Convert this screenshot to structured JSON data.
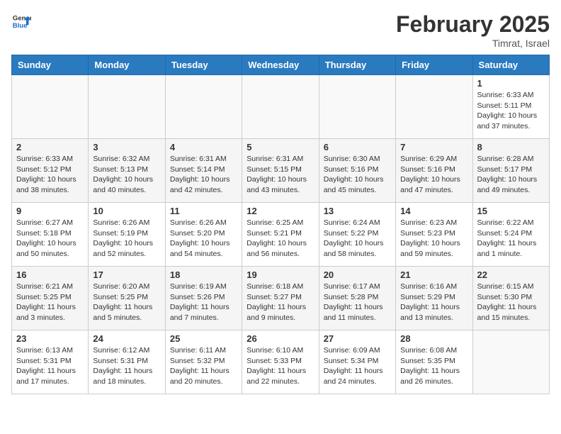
{
  "header": {
    "logo_general": "General",
    "logo_blue": "Blue",
    "month_year": "February 2025",
    "location": "Timrat, Israel"
  },
  "days_of_week": [
    "Sunday",
    "Monday",
    "Tuesday",
    "Wednesday",
    "Thursday",
    "Friday",
    "Saturday"
  ],
  "weeks": [
    [
      {
        "day": "",
        "info": ""
      },
      {
        "day": "",
        "info": ""
      },
      {
        "day": "",
        "info": ""
      },
      {
        "day": "",
        "info": ""
      },
      {
        "day": "",
        "info": ""
      },
      {
        "day": "",
        "info": ""
      },
      {
        "day": "1",
        "info": "Sunrise: 6:33 AM\nSunset: 5:11 PM\nDaylight: 10 hours\nand 37 minutes."
      }
    ],
    [
      {
        "day": "2",
        "info": "Sunrise: 6:33 AM\nSunset: 5:12 PM\nDaylight: 10 hours\nand 38 minutes."
      },
      {
        "day": "3",
        "info": "Sunrise: 6:32 AM\nSunset: 5:13 PM\nDaylight: 10 hours\nand 40 minutes."
      },
      {
        "day": "4",
        "info": "Sunrise: 6:31 AM\nSunset: 5:14 PM\nDaylight: 10 hours\nand 42 minutes."
      },
      {
        "day": "5",
        "info": "Sunrise: 6:31 AM\nSunset: 5:15 PM\nDaylight: 10 hours\nand 43 minutes."
      },
      {
        "day": "6",
        "info": "Sunrise: 6:30 AM\nSunset: 5:16 PM\nDaylight: 10 hours\nand 45 minutes."
      },
      {
        "day": "7",
        "info": "Sunrise: 6:29 AM\nSunset: 5:16 PM\nDaylight: 10 hours\nand 47 minutes."
      },
      {
        "day": "8",
        "info": "Sunrise: 6:28 AM\nSunset: 5:17 PM\nDaylight: 10 hours\nand 49 minutes."
      }
    ],
    [
      {
        "day": "9",
        "info": "Sunrise: 6:27 AM\nSunset: 5:18 PM\nDaylight: 10 hours\nand 50 minutes."
      },
      {
        "day": "10",
        "info": "Sunrise: 6:26 AM\nSunset: 5:19 PM\nDaylight: 10 hours\nand 52 minutes."
      },
      {
        "day": "11",
        "info": "Sunrise: 6:26 AM\nSunset: 5:20 PM\nDaylight: 10 hours\nand 54 minutes."
      },
      {
        "day": "12",
        "info": "Sunrise: 6:25 AM\nSunset: 5:21 PM\nDaylight: 10 hours\nand 56 minutes."
      },
      {
        "day": "13",
        "info": "Sunrise: 6:24 AM\nSunset: 5:22 PM\nDaylight: 10 hours\nand 58 minutes."
      },
      {
        "day": "14",
        "info": "Sunrise: 6:23 AM\nSunset: 5:23 PM\nDaylight: 10 hours\nand 59 minutes."
      },
      {
        "day": "15",
        "info": "Sunrise: 6:22 AM\nSunset: 5:24 PM\nDaylight: 11 hours\nand 1 minute."
      }
    ],
    [
      {
        "day": "16",
        "info": "Sunrise: 6:21 AM\nSunset: 5:25 PM\nDaylight: 11 hours\nand 3 minutes."
      },
      {
        "day": "17",
        "info": "Sunrise: 6:20 AM\nSunset: 5:25 PM\nDaylight: 11 hours\nand 5 minutes."
      },
      {
        "day": "18",
        "info": "Sunrise: 6:19 AM\nSunset: 5:26 PM\nDaylight: 11 hours\nand 7 minutes."
      },
      {
        "day": "19",
        "info": "Sunrise: 6:18 AM\nSunset: 5:27 PM\nDaylight: 11 hours\nand 9 minutes."
      },
      {
        "day": "20",
        "info": "Sunrise: 6:17 AM\nSunset: 5:28 PM\nDaylight: 11 hours\nand 11 minutes."
      },
      {
        "day": "21",
        "info": "Sunrise: 6:16 AM\nSunset: 5:29 PM\nDaylight: 11 hours\nand 13 minutes."
      },
      {
        "day": "22",
        "info": "Sunrise: 6:15 AM\nSunset: 5:30 PM\nDaylight: 11 hours\nand 15 minutes."
      }
    ],
    [
      {
        "day": "23",
        "info": "Sunrise: 6:13 AM\nSunset: 5:31 PM\nDaylight: 11 hours\nand 17 minutes."
      },
      {
        "day": "24",
        "info": "Sunrise: 6:12 AM\nSunset: 5:31 PM\nDaylight: 11 hours\nand 18 minutes."
      },
      {
        "day": "25",
        "info": "Sunrise: 6:11 AM\nSunset: 5:32 PM\nDaylight: 11 hours\nand 20 minutes."
      },
      {
        "day": "26",
        "info": "Sunrise: 6:10 AM\nSunset: 5:33 PM\nDaylight: 11 hours\nand 22 minutes."
      },
      {
        "day": "27",
        "info": "Sunrise: 6:09 AM\nSunset: 5:34 PM\nDaylight: 11 hours\nand 24 minutes."
      },
      {
        "day": "28",
        "info": "Sunrise: 6:08 AM\nSunset: 5:35 PM\nDaylight: 11 hours\nand 26 minutes."
      },
      {
        "day": "",
        "info": ""
      }
    ]
  ]
}
